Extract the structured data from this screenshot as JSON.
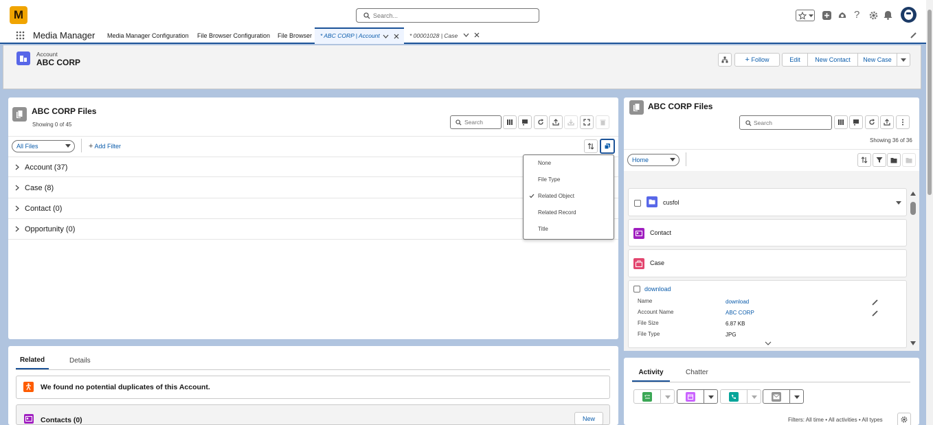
{
  "header": {
    "logo_text": "M",
    "search_placeholder": "Search..."
  },
  "nav": {
    "app_name": "Media Manager",
    "tabs": [
      {
        "label": "Media Manager Configuration"
      },
      {
        "label": "File Browser Configuration"
      },
      {
        "label": "File Browser"
      },
      {
        "label": "* ABC CORP | Account"
      },
      {
        "label": "* 00001028 | Case"
      }
    ]
  },
  "record": {
    "object_label": "Account",
    "name": "ABC CORP",
    "actions": {
      "follow": "Follow",
      "edit": "Edit",
      "new_contact": "New Contact",
      "new_case": "New Case"
    }
  },
  "left_files": {
    "title": "ABC CORP Files",
    "showing": "Showing 0 of 45",
    "search_placeholder": "Search",
    "filter_select": "All Files",
    "add_filter": "Add Filter",
    "groups": [
      {
        "label": "Account (37)"
      },
      {
        "label": "Case (8)"
      },
      {
        "label": "Contact (0)"
      },
      {
        "label": "Opportunity (0)"
      }
    ],
    "group_menu": {
      "items": [
        {
          "label": "None",
          "checked": false
        },
        {
          "label": "File Type",
          "checked": false
        },
        {
          "label": "Related Object",
          "checked": true
        },
        {
          "label": "Related Record",
          "checked": false
        },
        {
          "label": "Title",
          "checked": false
        }
      ]
    }
  },
  "related": {
    "tabs": {
      "related": "Related",
      "details": "Details"
    },
    "duplicates_msg": "We found no potential duplicates of this Account.",
    "contacts_title": "Contacts (0)",
    "new_label": "New"
  },
  "right_files": {
    "title": "ABC CORP Files",
    "search_placeholder": "Search",
    "showing": "Showing 36 of 36",
    "folder_select": "Home",
    "items": {
      "folder": "cusfol",
      "contact": "Contact",
      "case": "Case",
      "file_link": "download"
    },
    "fields": {
      "name_label": "Name",
      "name_value": "download",
      "account_label": "Account Name",
      "account_value": "ABC CORP",
      "size_label": "File Size",
      "size_value": "6.87 KB",
      "type_label": "File Type",
      "type_value": "JPG"
    }
  },
  "activity": {
    "tabs": {
      "activity": "Activity",
      "chatter": "Chatter"
    },
    "filters": "Filters: All time • All activities • All types"
  },
  "colors": {
    "brand": "#0b5cab",
    "account_icon": "#5867e8",
    "folder_icon": "#5867e8",
    "contact_icon": "#a020c0",
    "case_icon": "#e3466f",
    "warning_icon": "#fe5c00",
    "task_icon": "#3ba755",
    "event_icon": "#cb65ff",
    "call_icon": "#06a59a",
    "email_icon": "#939393"
  }
}
